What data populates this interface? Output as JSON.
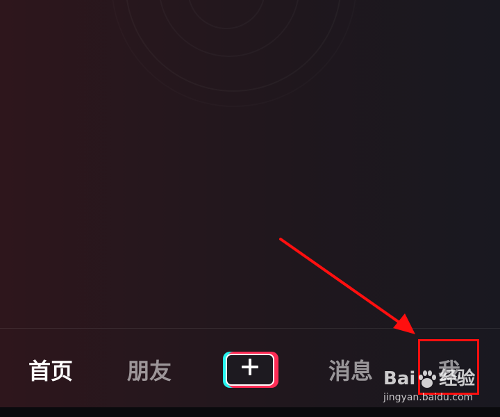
{
  "tabbar": {
    "tabs": [
      {
        "label": "首页",
        "active": true
      },
      {
        "label": "朋友",
        "active": false
      },
      {
        "label": "消息",
        "active": false
      },
      {
        "label": "我",
        "active": false
      }
    ],
    "create_button": {
      "icon": "plus-icon"
    }
  },
  "annotation": {
    "color": "#ff0f0f",
    "arrow_icon": "arrow-icon",
    "target": "我"
  },
  "watermark": {
    "logo_text_left": "Bai",
    "logo_text_right": "经验",
    "logo_icon": "paw-icon",
    "url": "jingyan.baidu.com"
  },
  "colors": {
    "brand_cyan": "#25f4ee",
    "brand_pink": "#fe2c55"
  }
}
